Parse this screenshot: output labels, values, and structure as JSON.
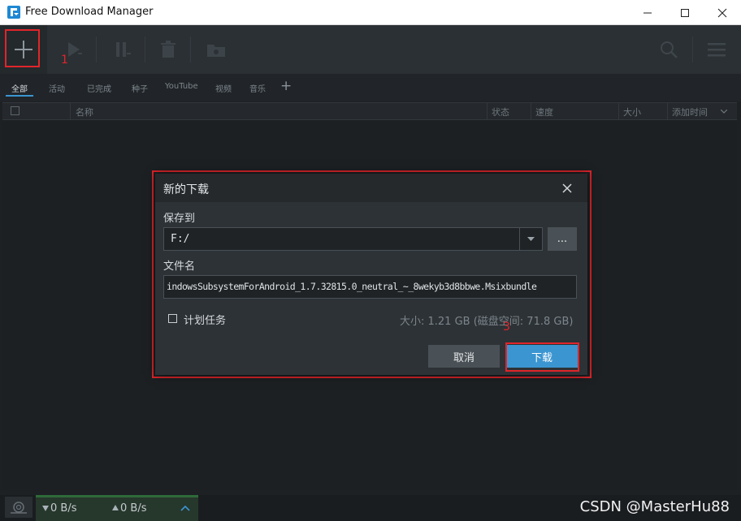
{
  "window": {
    "title": "Free Download Manager",
    "minimize_glyph": "—",
    "maximize_glyph": "☐",
    "close_glyph": "✕"
  },
  "toolbar": {
    "add_icon": "plus-icon",
    "icons": [
      "plus-icon",
      "play-icon",
      "pause-icon",
      "trash-icon",
      "folder-icon",
      "search-icon",
      "menu-icon"
    ]
  },
  "tabs": {
    "items": [
      "全部",
      "活动",
      "已完成",
      "种子",
      "YouTube",
      "视频",
      "音乐"
    ],
    "add_label": "+"
  },
  "table": {
    "headers": {
      "name": "名称",
      "status": "状态",
      "speed": "速度",
      "size": "大小",
      "added": "添加时间"
    }
  },
  "status_bar": {
    "download_speed": "0 B/s",
    "upload_speed": "0 B/s"
  },
  "dialog": {
    "title": "新的下载",
    "save_to_label": "保存到",
    "save_to_value": "F:/",
    "browse_label": "...",
    "filename_label": "文件名",
    "filename_value": "indowsSubsystemForAndroid_1.7.32815.0_neutral_~_8wekyb3d8bbwe.Msixbundle",
    "schedule_label": "计划任务",
    "size_info": "大小: 1.21 GB (磁盘空间: 71.8 GB)",
    "cancel_label": "取消",
    "download_label": "下载",
    "close_glyph": "✕"
  },
  "annotations": {
    "step1": "1",
    "step3": "3"
  },
  "watermark": "CSDN @MasterHu88",
  "colors": {
    "accent": "#3b95d1",
    "annotation_red": "#e0252b",
    "speed_green": "#2e6b3a"
  }
}
